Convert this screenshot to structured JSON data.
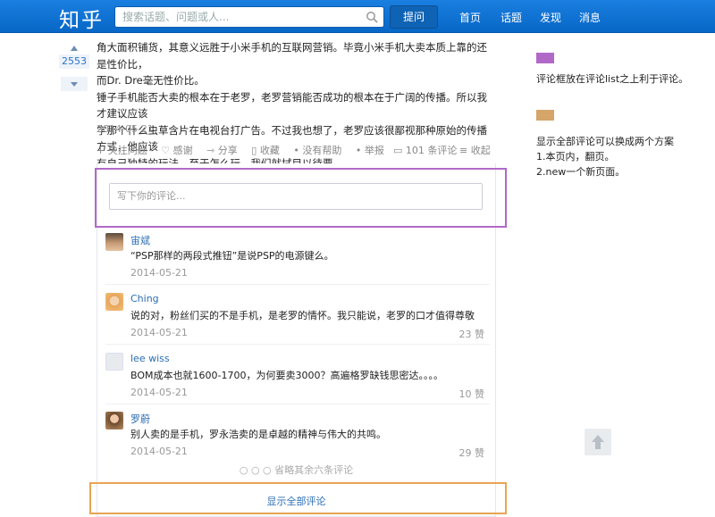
{
  "header": {
    "logo": "知乎",
    "search_placeholder": "搜索话题、问题或人...",
    "ask_label": "提问",
    "nav": [
      "首页",
      "话题",
      "发现",
      "消息"
    ]
  },
  "vote": {
    "count": "2553"
  },
  "answer": {
    "lines": [
      "角大面积铺货，其意义远胜于小米手机的互联网营销。毕竟小米手机大卖本质上靠的还是性价比，",
      "而Dr. Dre毫无性价比。",
      "锤子手机能否大卖的根本在于老罗，老罗营销能否成功的根本在于广阔的传播。所以我才建议应该",
      "学那个什么虫草含片在电视台打广告。不过我也想了，老罗应该很鄙视那种原始的传播方式，他应该",
      "有自己独特的玩法。至于怎么玩，我们就拭目以待要。"
    ],
    "date": "2014-05-21"
  },
  "actions": {
    "follow": "+ 关注问题",
    "thanks": "♡ 感谢",
    "share": "⇾ 分享",
    "collect": "▯ 收藏",
    "no_help": "• 没有帮助",
    "report": "• 举报",
    "comments_count": "▭ 101 条评论",
    "collapse": "≡ 收起"
  },
  "comments": {
    "placeholder": "写下你的评论...",
    "items": [
      {
        "name": "宙斌",
        "text": "“PSP那样的两段式推钮”是说PSP的电源键么。",
        "date": "2014-05-21",
        "likes": ""
      },
      {
        "name": "Ching",
        "text": "说的对，粉丝们买的不是手机，是老罗的情怀。我只能说，老罗的口才值得尊敬",
        "date": "2014-05-21",
        "likes": "23 赞"
      },
      {
        "name": "lee wiss",
        "text": "BOM成本也就1600-1700，为何要卖3000？高遍格罗缺钱思密达。。。。",
        "date": "2014-05-21",
        "likes": "10 赞"
      },
      {
        "name": "罗蔚",
        "text": "别人卖的是手机，罗永浩卖的是卓越的精神与伟大的共鸣。",
        "date": "2014-05-21",
        "likes": "29 赞"
      }
    ],
    "omitted": "○ ○ ○  省略其余六条评论",
    "show_all": "显示全部评论"
  },
  "annotations": {
    "purple_color": "#b169c8",
    "orange_color": "#d6a56a",
    "note1": "评论框放在评论list之上利于评论。",
    "note2_title": "显示全部评论可以换成两个方案",
    "note2_a": "1.本页内，翻页。",
    "note2_b": "2.new一个新页面。"
  }
}
